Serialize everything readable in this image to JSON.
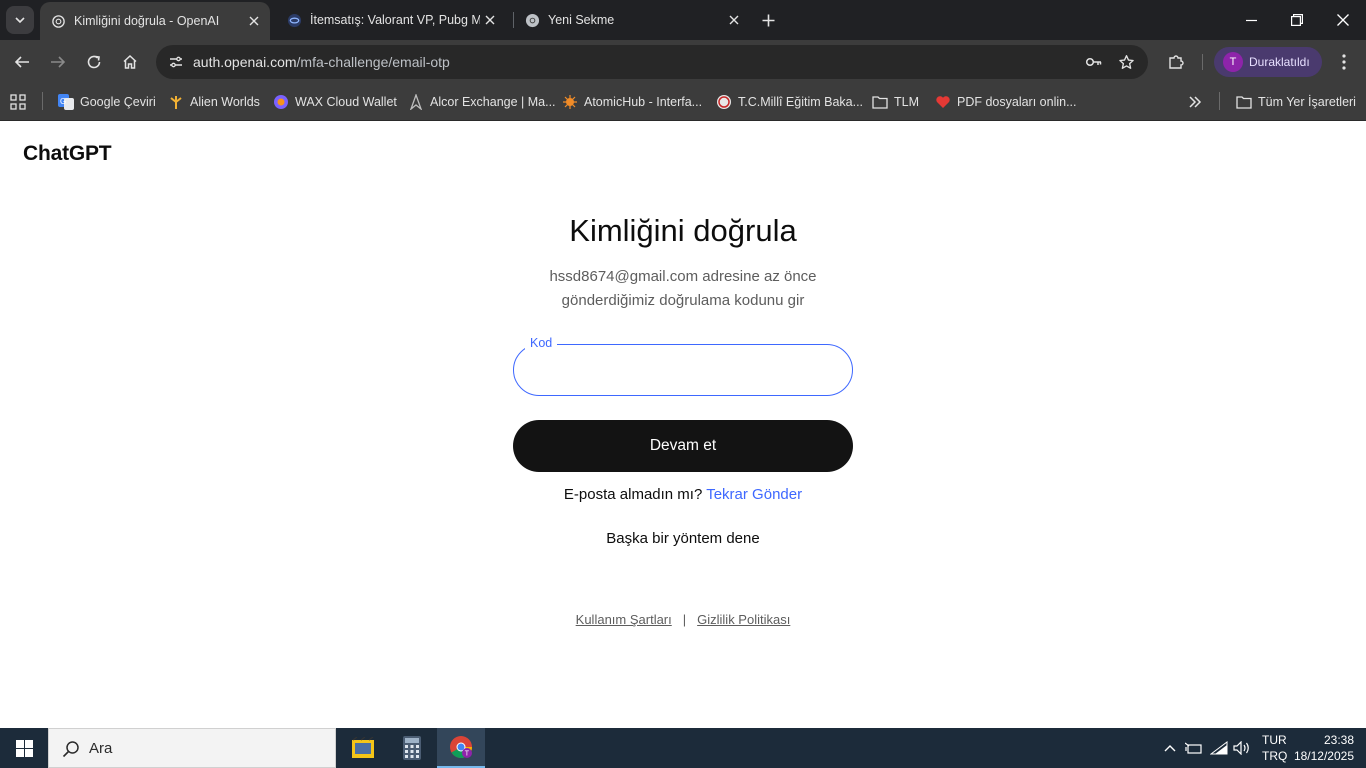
{
  "browser": {
    "tabs": [
      {
        "title": "Kimliğini doğrula - OpenAI",
        "active": true,
        "icon": "openai-icon"
      },
      {
        "title": "İtemsatış: Valorant VP, Pubg Mobile",
        "active": false,
        "icon": "itemsatis-icon"
      },
      {
        "title": "Yeni Sekme",
        "active": false,
        "icon": "chrome-icon"
      }
    ],
    "url_host": "auth.openai.com",
    "url_path": "/mfa-challenge/email-otp",
    "profile_initial": "T",
    "profile_name": "Duraklatıldı",
    "bookmarks": [
      {
        "label": "Google Çeviri",
        "icon": "google-translate-icon"
      },
      {
        "label": "Alien Worlds",
        "icon": "alien-worlds-icon"
      },
      {
        "label": "WAX Cloud Wallet",
        "icon": "wax-icon"
      },
      {
        "label": "Alcor Exchange | Ma...",
        "icon": "alcor-icon"
      },
      {
        "label": "AtomicHub - Interfa...",
        "icon": "atomichub-icon"
      },
      {
        "label": "T.C.Millî Eğitim Baka...",
        "icon": "meb-icon"
      },
      {
        "label": "TLM",
        "icon": "folder-icon"
      },
      {
        "label": "PDF dosyaları onlin...",
        "icon": "heart-pdf-icon"
      }
    ],
    "all_bookmarks_label": "Tüm Yer İşaretleri"
  },
  "page": {
    "logo": "ChatGPT",
    "heading": "Kimliğini doğrula",
    "subtitle_line1": "hssd8674@gmail.com adresine az önce",
    "subtitle_line2": "gönderdiğimiz doğrulama kodunu gir",
    "code_label": "Kod",
    "code_value": "",
    "continue_label": "Devam et",
    "no_email_text": "E-posta almadın mı?",
    "resend_label": "Tekrar Gönder",
    "other_method_label": "Başka bir yöntem dene",
    "terms_label": "Kullanım Şartları",
    "separator": "|",
    "privacy_label": "Gizlilik Politikası"
  },
  "taskbar": {
    "search_placeholder": "Ara",
    "lang_line1": "TUR",
    "lang_line2": "TRQ",
    "time": "23:38",
    "date": "18/12/2025"
  },
  "colors": {
    "accent_blue": "#3e68ff",
    "button_dark": "#131313",
    "chrome_dark": "#3c3c3c",
    "taskbar_bg": "#1c2b3a"
  }
}
